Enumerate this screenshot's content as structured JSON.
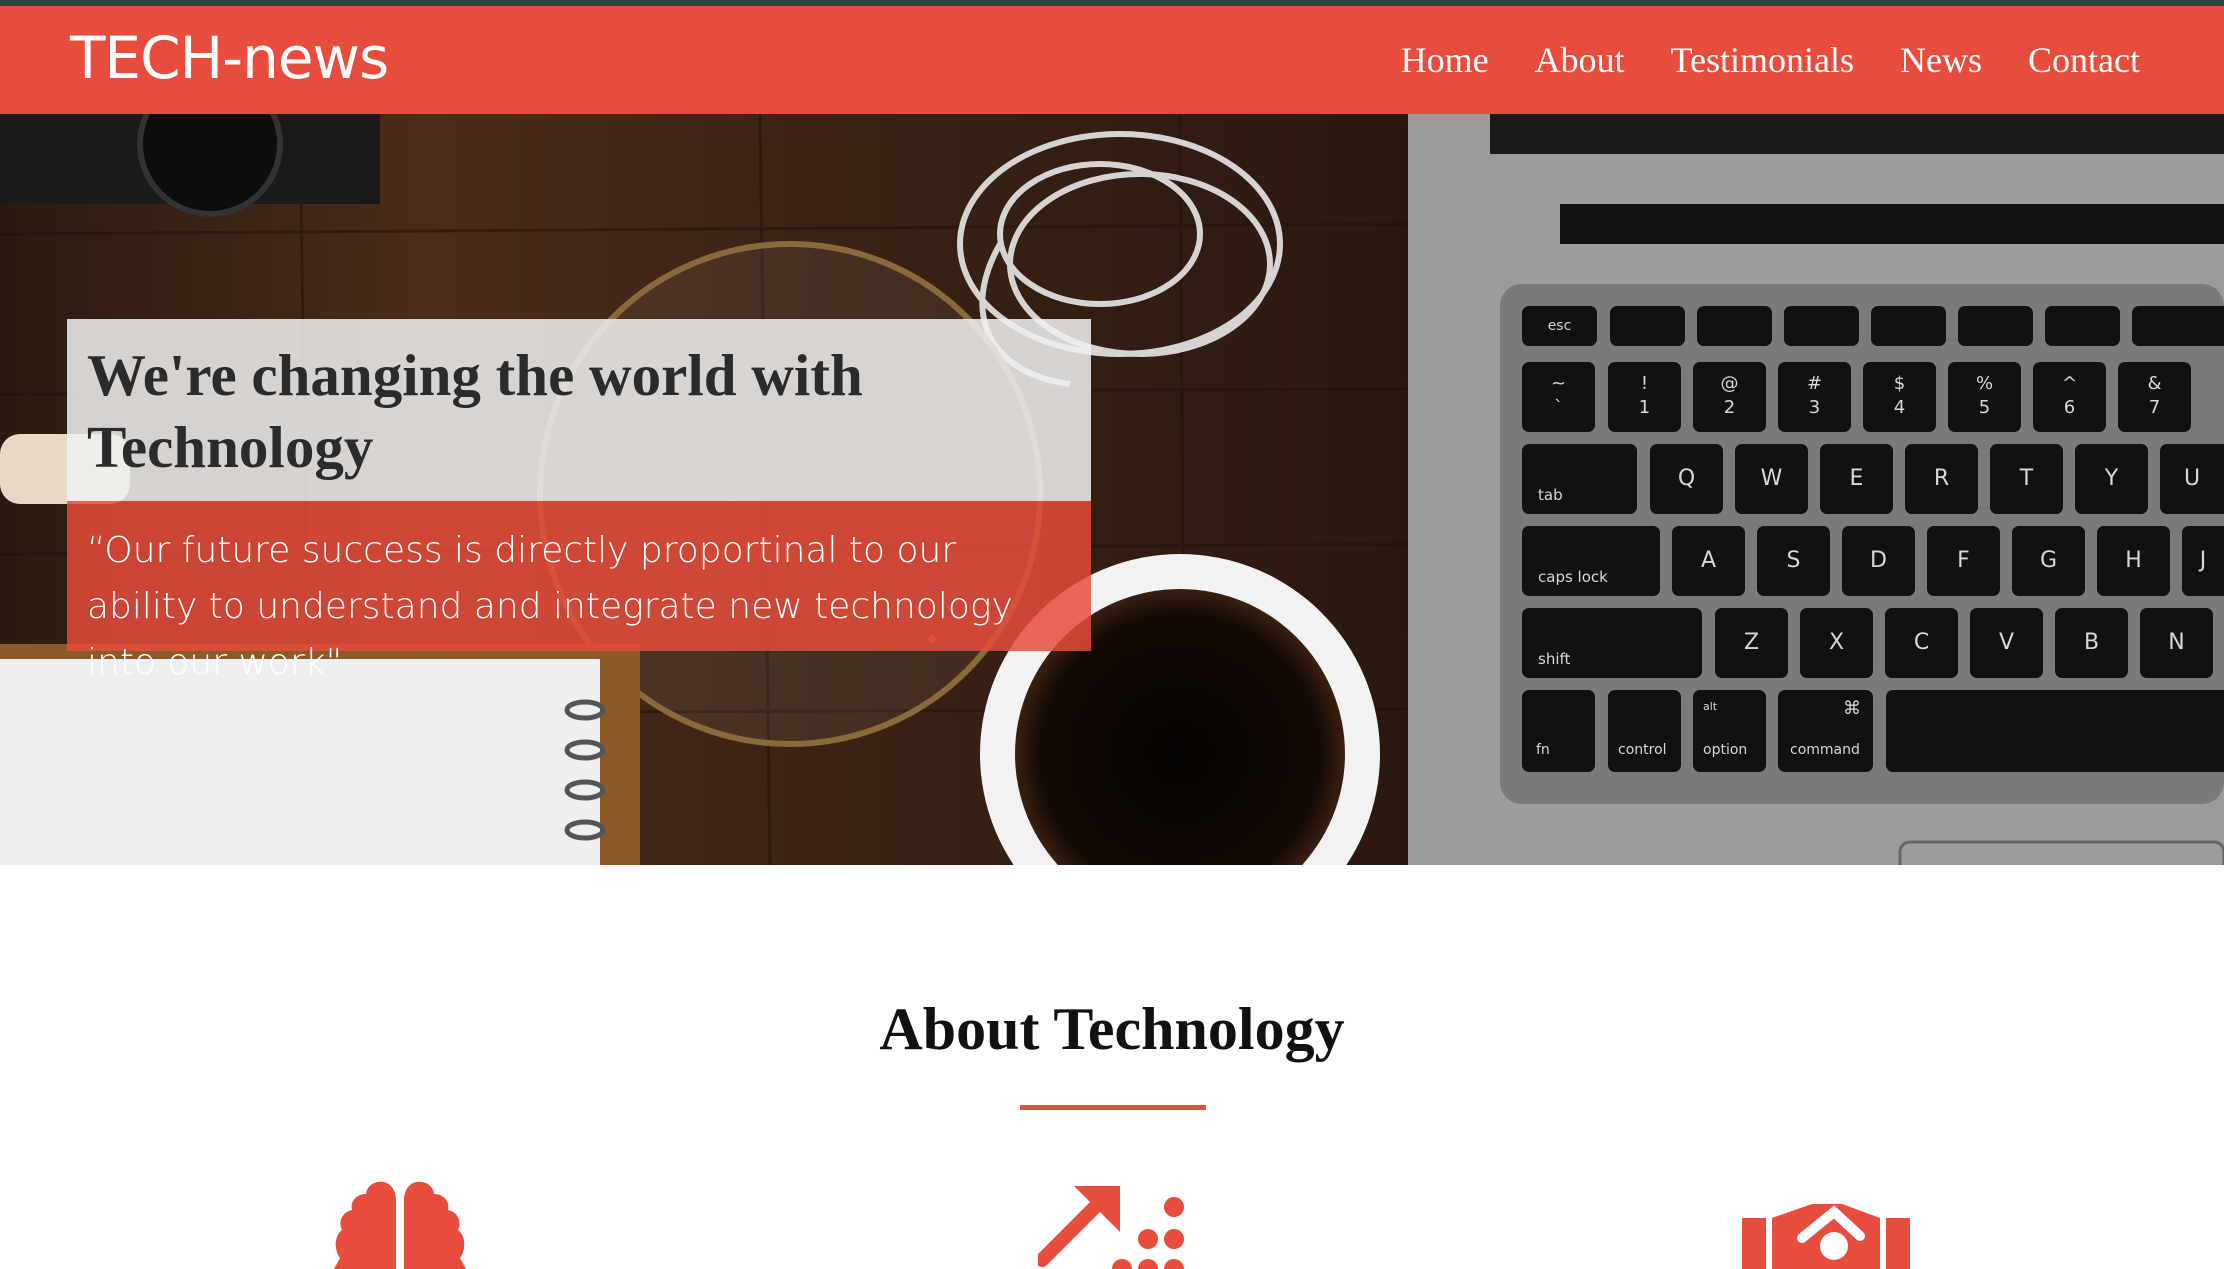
{
  "brand": {
    "name": "TECH-news"
  },
  "nav": {
    "items": [
      "Home",
      "About",
      "Testimonials",
      "News",
      "Contact"
    ]
  },
  "hero": {
    "title": "We're changing the world with Technology",
    "quote": "“Our future success is directly proportinal to our ability to understand and integrate new technology into our work\""
  },
  "keyboard": {
    "row1": [
      "esc",
      "",
      "",
      "",
      "",
      "",
      "",
      ""
    ],
    "row2": [
      [
        "~",
        "`"
      ],
      [
        "!",
        "1"
      ],
      [
        "@",
        "2"
      ],
      [
        "#",
        "3"
      ],
      [
        "$",
        "4"
      ],
      [
        "%",
        "5"
      ],
      [
        "^",
        "6"
      ],
      [
        "&",
        "7"
      ]
    ],
    "row3": [
      "tab",
      "Q",
      "W",
      "E",
      "R",
      "T",
      "Y",
      "U"
    ],
    "row4": [
      "caps lock",
      "A",
      "S",
      "D",
      "F",
      "G",
      "H",
      "J"
    ],
    "row5": [
      "shift",
      "Z",
      "X",
      "C",
      "V",
      "B",
      "N"
    ],
    "row6": [
      "fn",
      "control",
      "option",
      "command",
      ""
    ],
    "alt_label": "alt",
    "cmd_symbol": "⌘"
  },
  "about": {
    "heading": "About Technology"
  },
  "icons": [
    "brain-icon",
    "growth-chart-icon",
    "handshake-icon"
  ],
  "colors": {
    "accent": "#e74c3c",
    "dark": "#3c3c3c"
  }
}
